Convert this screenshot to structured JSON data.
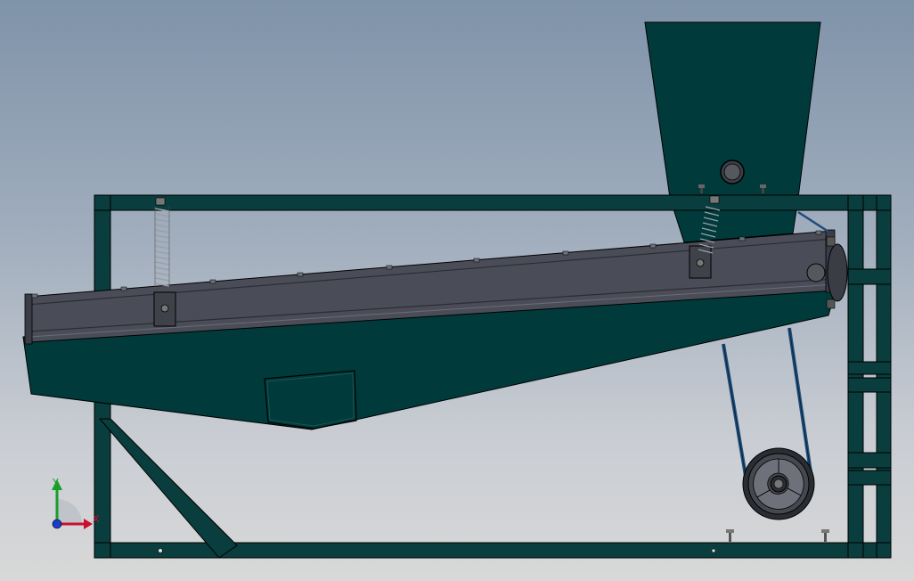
{
  "viewport": {
    "background_top": "#7f93a9",
    "background_bottom": "#d8d8d8"
  },
  "colors": {
    "frame": "#0a3d3d",
    "body_teal": "#013a3a",
    "screen_gray": "#4a4d57",
    "screen_edge": "#2b2d33",
    "spring": "#8a8f99",
    "belt": "#1f4e7a",
    "pulley": "#2a2d33",
    "axis_x": "#c8102e",
    "axis_y": "#1a9e2a",
    "axis_z": "#1a3ccf"
  },
  "triad": {
    "x_label": "X",
    "y_label": "Y",
    "icon": "coordinate-triad-icon"
  }
}
